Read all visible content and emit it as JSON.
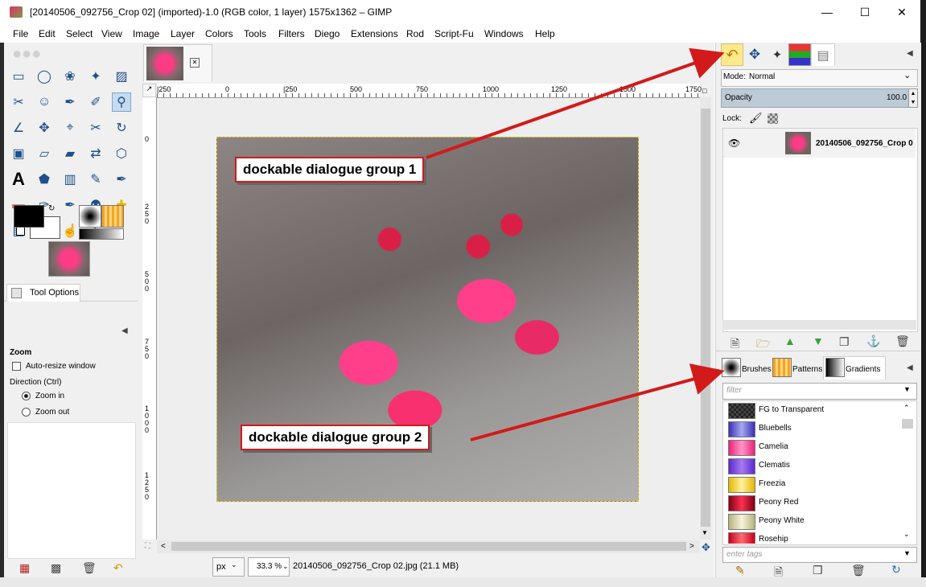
{
  "window": {
    "title": "[20140506_092756_Crop 02] (imported)-1.0 (RGB color, 1 layer) 1575x1362 – GIMP",
    "minimize": "—",
    "maximize": "☐",
    "close": "✕"
  },
  "menu": [
    "File",
    "Edit",
    "Select",
    "View",
    "Image",
    "Layer",
    "Colors",
    "Tools",
    "Filters",
    "Diego",
    "Extensions",
    "Rod",
    "Script-Fu",
    "Windows",
    "Help"
  ],
  "toolbox": {
    "tools": [
      "rect-select-icon",
      "ellipse-select-icon",
      "lasso-icon",
      "fuzzy-select-icon",
      "color-select-icon",
      "scissors-icon",
      "foreground-select-icon",
      "paths-icon",
      "color-picker-icon",
      "zoom-icon",
      "measure-icon",
      "move-icon",
      "align-icon",
      "crop-icon",
      "rotate-icon",
      "scale-icon",
      "shear-icon",
      "perspective-icon",
      "flip-icon",
      "cage-icon",
      "text-icon",
      "bucket-fill-icon",
      "blend-icon",
      "pencil-icon",
      "paintbrush-icon",
      "eraser-icon",
      "airbrush-icon",
      "ink-icon",
      "clone-icon",
      "heal-icon",
      "perspective-clone-icon",
      "blur-icon",
      "smudge-icon",
      "dodge-burn-icon"
    ],
    "selected_tool": "zoom-icon"
  },
  "tool_options": {
    "tab_label": "Tool Options",
    "heading": "Zoom",
    "auto_resize": "Auto-resize window",
    "direction_label": "Direction  (Ctrl)",
    "zoom_in": "Zoom in",
    "zoom_out": "Zoom out"
  },
  "rulers": {
    "h_ticks": [
      "|250",
      "0",
      "|250",
      "500",
      "750",
      "1000",
      "1250",
      "1500",
      "1750"
    ],
    "v_ticks": [
      "0",
      "2\n5\n0",
      "5\n0\n0",
      "7\n5\n0",
      "1\n0\n0\n0",
      "1\n2\n5\n0"
    ]
  },
  "status": {
    "unit": "px",
    "zoom": "33.3 %",
    "info": "20140506_092756_Crop 02.jpg (21.1 MB)"
  },
  "layers": {
    "mode_label": "Mode:",
    "mode_value": "Normal",
    "opacity_label": "Opacity",
    "opacity_value": "100.0",
    "lock_label": "Lock:",
    "layer_name": "20140506_092756_Crop 0"
  },
  "group2": {
    "tabs": [
      "Brushes",
      "Patterns",
      "Gradients"
    ],
    "filter_placeholder": "filter",
    "tags_placeholder": "enter tags",
    "gradients": [
      {
        "name": "FG to Transparent",
        "colors": [
          "#111111",
          "#c9c9c9"
        ]
      },
      {
        "name": "Bluebells",
        "colors": [
          "#3a2fb6",
          "#a6a8f2"
        ]
      },
      {
        "name": "Camelia",
        "colors": [
          "#e8237d",
          "#ff97c6"
        ]
      },
      {
        "name": "Clematis",
        "colors": [
          "#5c2ad0",
          "#a779f0"
        ]
      },
      {
        "name": "Freezia",
        "colors": [
          "#e6b600",
          "#fff1a0"
        ]
      },
      {
        "name": "Peony Red",
        "colors": [
          "#7f0016",
          "#ff3050"
        ]
      },
      {
        "name": "Peony White",
        "colors": [
          "#b7b27c",
          "#f7f4da"
        ]
      },
      {
        "name": "Rosehip",
        "colors": [
          "#c9001e",
          "#ff6e6e"
        ]
      }
    ]
  },
  "callouts": {
    "group1": "dockable dialogue group 1",
    "group2": "dockable dialogue group 2"
  },
  "colors": {
    "arrow": "#d21a1a",
    "selection": "#c7dbf0"
  }
}
